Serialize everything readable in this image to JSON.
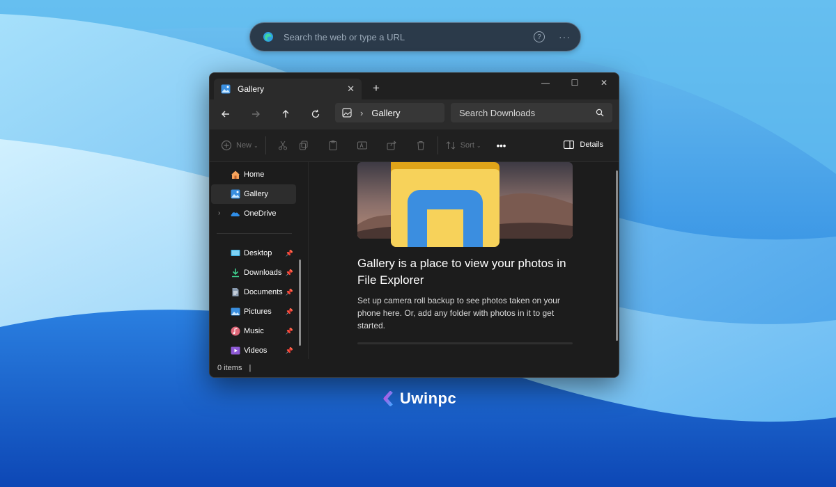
{
  "colors": {
    "accent": "#4cc2ff",
    "window_bg": "#1c1c1c",
    "toolbar_bg": "#202020",
    "nav_bg": "#2b2b2b",
    "watermark_gradient": [
      "#c44bdc",
      "#4aa3ff"
    ]
  },
  "edge": {
    "placeholder": "Search the web or type a URL",
    "icons": [
      "edge-logo-icon",
      "help-icon",
      "more-icon"
    ]
  },
  "window": {
    "tab_title": "Gallery",
    "tab_close": "✕",
    "new_tab": "+",
    "controls": {
      "minimize": "—",
      "maximize": "☐",
      "close": "✕"
    },
    "nav": {
      "breadcrumb_sep": "›",
      "location": "Gallery",
      "search_placeholder": "Search Downloads"
    },
    "toolbar": {
      "new_label": "New",
      "sort_label": "Sort",
      "more_label": "•••",
      "details_label": "Details"
    },
    "sidebar": {
      "items": [
        {
          "label": "Home",
          "icon": "home-icon"
        },
        {
          "label": "Gallery",
          "icon": "gallery-icon",
          "selected": true
        },
        {
          "label": "OneDrive",
          "icon": "onedrive-icon",
          "expandable": true
        },
        {
          "label": "Desktop",
          "icon": "desktop-icon",
          "pinned": true
        },
        {
          "label": "Downloads",
          "icon": "downloads-icon",
          "pinned": true
        },
        {
          "label": "Documents",
          "icon": "documents-icon",
          "pinned": true
        },
        {
          "label": "Pictures",
          "icon": "pictures-icon",
          "pinned": true
        },
        {
          "label": "Music",
          "icon": "music-icon",
          "pinned": true
        },
        {
          "label": "Videos",
          "icon": "videos-icon",
          "pinned": true
        }
      ]
    },
    "content": {
      "heading": "Gallery is a place to view your photos in File Explorer",
      "description": "Set up camera roll backup to see photos taken on your phone here. Or, add any folder with photos in it to get started."
    },
    "status": {
      "items_text": "0 items",
      "separator": "|"
    }
  },
  "watermark": {
    "text": "Uwinpc"
  }
}
